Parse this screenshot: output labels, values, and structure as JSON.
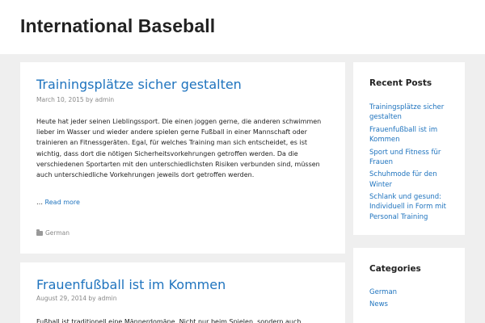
{
  "site": {
    "title": "International Baseball"
  },
  "posts": [
    {
      "title": "Trainingsplätze sicher gestalten",
      "date": "March 10, 2015",
      "by": "by",
      "author": "admin",
      "excerpt": "Heute hat jeder seinen Lieblingssport. Die einen joggen gerne, die anderen schwimmen lieber im Wasser und wieder andere spielen gerne Fußball in einer Mannschaft oder trainieren an Fitnessgeräten. Egal, für welches Training man sich entscheidet, es ist wichtig, dass dort die nötigen Sicherheitsvorkehrungen getroffen werden. Da die verschiedenen Sportarten mit den unterschiedlichsten Risiken verbunden sind, müssen auch unterschiedliche Vorkehrungen jeweils dort getroffen werden.",
      "read_more_prefix": "…",
      "read_more": "Read more",
      "category": "German",
      "category_icon": "folder-icon"
    },
    {
      "title": "Frauenfußball ist im Kommen",
      "date": "August 29, 2014",
      "by": "by",
      "author": "admin",
      "excerpt": "Fußball ist traditionell eine Männerdomäne. Nicht nur beim Spielen, sondern auch"
    }
  ],
  "sidebar": {
    "recent_posts": {
      "title": "Recent Posts",
      "items": [
        "Trainingsplätze sicher gestalten",
        "Frauenfußball ist im Kommen",
        "Sport und Fitness für Frauen",
        "Schuhmode für den Winter",
        "Schlank und gesund: Individuell in Form mit Personal Training"
      ]
    },
    "categories": {
      "title": "Categories",
      "items": [
        "German",
        "News"
      ]
    }
  },
  "colors": {
    "link": "#1e73be",
    "background": "#efefef",
    "card": "#ffffff",
    "text": "#222222",
    "meta": "#888888"
  }
}
